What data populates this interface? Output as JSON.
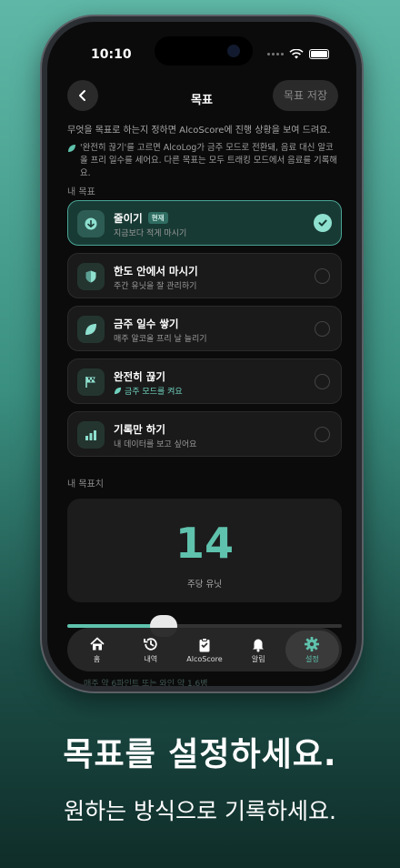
{
  "status": {
    "time": "10:10"
  },
  "header": {
    "title": "목표",
    "save_label": "목표 저장"
  },
  "description": "무엇을 목표로 하는지 정하면 AlcoScore에 진행 상황을 보여 드려요.",
  "note": "'완전히 끊기'를 고르면 AlcoLog가 금주 모드로 전환돼, 음료 대신 알코올 프리 일수를 세어요. 다른 목표는 모두 트래킹 모드에서 음료를 기록해요.",
  "goals_section_label": "내 목표",
  "goals": [
    {
      "title": "줄이기",
      "badge": "현재",
      "subtitle": "지금보다 적게 마시기",
      "selected": true,
      "icon": "arrow-down-icon"
    },
    {
      "title": "한도 안에서 마시기",
      "subtitle": "주간 유닛을 잘 관리하기",
      "selected": false,
      "icon": "shield-icon"
    },
    {
      "title": "금주 일수 쌓기",
      "subtitle": "매주 알코올 프리 날 늘리기",
      "selected": false,
      "icon": "leaf-icon"
    },
    {
      "title": "완전히 끊기",
      "subtitle": "금주 모드를 켜요",
      "selected": false,
      "icon": "flag-icon"
    },
    {
      "title": "기록만 하기",
      "subtitle": "내 데이터를 보고 싶어요",
      "selected": false,
      "icon": "bars-icon"
    }
  ],
  "target_section_label": "내 목표치",
  "target": {
    "value": "14",
    "unit": "주당 유닛",
    "slider_fraction": 0.35
  },
  "tabs": [
    {
      "label": "홈",
      "icon": "home-icon",
      "active": false
    },
    {
      "label": "내역",
      "icon": "history-icon",
      "active": false
    },
    {
      "label": "AlcoScore",
      "icon": "clipboard-icon",
      "active": false
    },
    {
      "label": "알림",
      "icon": "bell-icon",
      "active": false
    },
    {
      "label": "설정",
      "icon": "gear-icon",
      "active": true
    }
  ],
  "footnote": "매주 약 6파인트 또는 와인 약 1.6병",
  "promo": {
    "headline": "목표를 설정하세요.",
    "subline": "원하는 방식으로 기록하세요."
  },
  "colors": {
    "accent": "#5fc2ad",
    "selected_bg": "#183a34",
    "selected_border": "#4aa596"
  }
}
